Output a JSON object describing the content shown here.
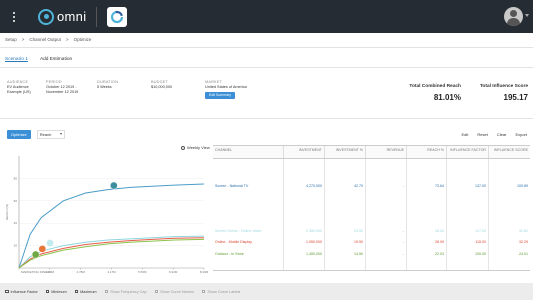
{
  "app": {
    "name": "omni"
  },
  "breadcrumb": {
    "items": [
      "Setup",
      "Channel Output",
      "Optimize"
    ],
    "sep": ">"
  },
  "tabs": [
    {
      "label": "Scenario 1"
    },
    {
      "label": "Add Estimation"
    }
  ],
  "summary": {
    "audience": {
      "label": "AUDIENCE",
      "value1": "EV Audience",
      "value2": "Example (US)"
    },
    "period": {
      "label": "PERIOD",
      "value1": "October 12 2019 -",
      "value2": "November 12 2019"
    },
    "duration": {
      "label": "DURATION",
      "value": "5 Weeks"
    },
    "budget": {
      "label": "BUDGET",
      "value": "$10,000,000"
    },
    "market": {
      "label": "MARKET",
      "value": "United States of America"
    },
    "edit_button": "Edit Summary"
  },
  "metrics": {
    "reach": {
      "label": "Total Combined Reach",
      "value": "81.01%"
    },
    "influence": {
      "label": "Total Influence Score",
      "value": "195.17"
    }
  },
  "toolbar": {
    "optimize": "Optimize",
    "metric_select": "Reach",
    "edit": "Edit",
    "reset": "Reset",
    "clear": "Clear",
    "export": "Export"
  },
  "weekly_view": "Weekly View",
  "chart_data": {
    "type": "line",
    "xlabel": "MARKETING SPEND",
    "ylabel": "REACH (%)",
    "x_ticks": [
      "",
      "1.39M",
      "2.78M",
      "4.17M",
      "5.56M",
      "6.94M",
      "8.33M"
    ],
    "y_ticks": [
      "",
      "20",
      "40",
      "60",
      "80"
    ],
    "series": [
      {
        "color": "#4a9cc8",
        "points": [
          [
            0,
            0
          ],
          [
            0.5,
            30
          ],
          [
            1,
            45
          ],
          [
            2,
            60
          ],
          [
            3,
            67
          ],
          [
            4,
            70
          ],
          [
            5,
            72
          ],
          [
            6,
            73
          ],
          [
            7,
            74
          ],
          [
            8.33,
            75
          ]
        ]
      },
      {
        "color": "#8fd6df",
        "points": [
          [
            0,
            0
          ],
          [
            0.5,
            10
          ],
          [
            1,
            15
          ],
          [
            2,
            20
          ],
          [
            3,
            23
          ],
          [
            4,
            25
          ],
          [
            5,
            26
          ],
          [
            6,
            27
          ],
          [
            7,
            28
          ],
          [
            8.33,
            28.5
          ]
        ]
      },
      {
        "color": "#e85c4a",
        "points": [
          [
            0,
            0
          ],
          [
            0.5,
            8
          ],
          [
            1,
            12.5
          ],
          [
            2,
            17.5
          ],
          [
            3,
            21
          ],
          [
            4,
            23
          ],
          [
            5,
            24.5
          ],
          [
            6,
            25.5
          ],
          [
            7,
            26.5
          ],
          [
            8.33,
            27
          ]
        ]
      },
      {
        "color": "#8bc34a",
        "points": [
          [
            0,
            0
          ],
          [
            0.5,
            7
          ],
          [
            1,
            11
          ],
          [
            2,
            16
          ],
          [
            3,
            19
          ],
          [
            4,
            21.5
          ],
          [
            5,
            23
          ],
          [
            6,
            24
          ],
          [
            7,
            25
          ],
          [
            8.33,
            25.5
          ]
        ]
      }
    ],
    "markers": [
      {
        "x": 4.27,
        "y": 73.6,
        "color": "#3c8f9f"
      },
      {
        "x": 1.4,
        "y": 22.3,
        "color": "#c2ebef"
      },
      {
        "x": 1.05,
        "y": 17.0,
        "color": "#e8753a"
      },
      {
        "x": 0.75,
        "y": 12.0,
        "color": "#6fa843"
      }
    ],
    "xlim": [
      0,
      8.33
    ],
    "ylim": [
      0,
      100
    ]
  },
  "table": {
    "headers": [
      "CHANNEL",
      "INVESTMENT",
      "INVESTMENT %",
      "REVENUE",
      "REACH %",
      "INFLUENCE FACTOR",
      "INFLUENCE SCORE"
    ],
    "rows": [
      {
        "channel": "Screen - National TV",
        "investment": "4,270,000",
        "inv_pct": "42.70",
        "revenue": "-",
        "reach": "73.64",
        "factor": "137.00",
        "score": "100.89",
        "color": "#2a6fa8"
      },
      {
        "channel": "Screen Online - Online Video",
        "investment": "2,350,000",
        "inv_pct": "23.50",
        "revenue": "-",
        "reach": "28.04",
        "factor": "117.00",
        "score": "32.81",
        "color": "#9fd8de"
      },
      {
        "channel": "Online - Mobile Display",
        "investment": "1,950,000",
        "inv_pct": "19.50",
        "revenue": "-",
        "reach": "28.09",
        "factor": "115.00",
        "score": "32.29",
        "color": "#d9442f"
      },
      {
        "channel": "Outdoor - In Store",
        "investment": "1,450,000",
        "inv_pct": "14.50",
        "revenue": "-",
        "reach": "22.03",
        "factor": "109.00",
        "score": "24.01",
        "color": "#5a9a2e"
      }
    ]
  },
  "footer": [
    {
      "label": "Influence Factor",
      "disabled": false
    },
    {
      "label": "Minimum",
      "disabled": false
    },
    {
      "label": "Maximum",
      "disabled": false
    },
    {
      "label": "Show Frequency Cap",
      "disabled": true
    },
    {
      "label": "Show Curve Names",
      "disabled": true
    },
    {
      "label": "Show Curve Labels",
      "disabled": true
    }
  ]
}
